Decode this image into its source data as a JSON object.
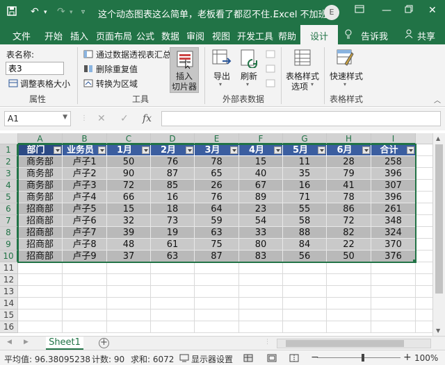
{
  "titlebar": {
    "title": "这个动态图表这么简单，老板看了都忍不住...",
    "app": "Excel 不加班",
    "avatar_letter": "E",
    "icons": [
      "save-icon",
      "undo-icon",
      "redo-icon",
      "customize-icon",
      "ribbon-display-icon",
      "minimize-icon",
      "restore-icon",
      "close-icon"
    ]
  },
  "tabs": [
    "文件",
    "开始",
    "插入",
    "页面布局",
    "公式",
    "数据",
    "审阅",
    "视图",
    "开发工具",
    "帮助",
    "设计",
    "告诉我",
    "共享"
  ],
  "active_tab": "设计",
  "ribbon": {
    "table_name_label": "表名称:",
    "table_name_value": "表3",
    "resize_table": "调整表格大小",
    "group_properties": "属性",
    "summarize_pivot": "通过数据透视表汇总",
    "remove_duplicates": "删除重复值",
    "convert_to_range": "转换为区域",
    "insert_slicer_line1": "插入",
    "insert_slicer_line2": "切片器",
    "group_tools": "工具",
    "export": "导出",
    "refresh": "刷新",
    "group_external": "外部表数据",
    "style_options_line1": "表格样式",
    "style_options_line2": "选项",
    "quick_styles": "快速样式",
    "group_styles": "表格样式"
  },
  "formula_bar": {
    "name_box": "A1",
    "cancel": "✕",
    "enter": "✓",
    "fx": "fx",
    "value": ""
  },
  "columns": [
    "A",
    "B",
    "C",
    "D",
    "E",
    "F",
    "G",
    "H",
    "I"
  ],
  "rows": [
    "1",
    "2",
    "3",
    "4",
    "5",
    "6",
    "7",
    "8",
    "9",
    "10",
    "11",
    "12",
    "13",
    "14",
    "15",
    "16"
  ],
  "table": {
    "headers": [
      "部门",
      "业务员",
      "1月",
      "2月",
      "3月",
      "4月",
      "5月",
      "6月",
      "合计"
    ],
    "data": [
      [
        "商务部",
        "卢子1",
        "50",
        "76",
        "78",
        "15",
        "11",
        "28",
        "258"
      ],
      [
        "商务部",
        "卢子2",
        "90",
        "87",
        "65",
        "40",
        "35",
        "79",
        "396"
      ],
      [
        "商务部",
        "卢子3",
        "72",
        "85",
        "26",
        "67",
        "16",
        "41",
        "307"
      ],
      [
        "商务部",
        "卢子4",
        "66",
        "16",
        "76",
        "89",
        "71",
        "78",
        "396"
      ],
      [
        "招商部",
        "卢子5",
        "15",
        "18",
        "64",
        "23",
        "55",
        "86",
        "261"
      ],
      [
        "招商部",
        "卢子6",
        "32",
        "73",
        "59",
        "54",
        "58",
        "72",
        "348"
      ],
      [
        "招商部",
        "卢子7",
        "39",
        "19",
        "63",
        "33",
        "88",
        "82",
        "324"
      ],
      [
        "招商部",
        "卢子8",
        "48",
        "61",
        "75",
        "80",
        "84",
        "22",
        "370"
      ],
      [
        "招商部",
        "卢子9",
        "37",
        "63",
        "87",
        "83",
        "56",
        "50",
        "376"
      ]
    ]
  },
  "sheet": {
    "tab": "Sheet1",
    "add": "+"
  },
  "status": {
    "average": "平均值: 96.38095238",
    "count": "计数: 90",
    "sum": "求和: 6072",
    "display_settings": "显示器设置",
    "zoom_minus": "−",
    "zoom_plus": "+",
    "zoom": "100%"
  }
}
